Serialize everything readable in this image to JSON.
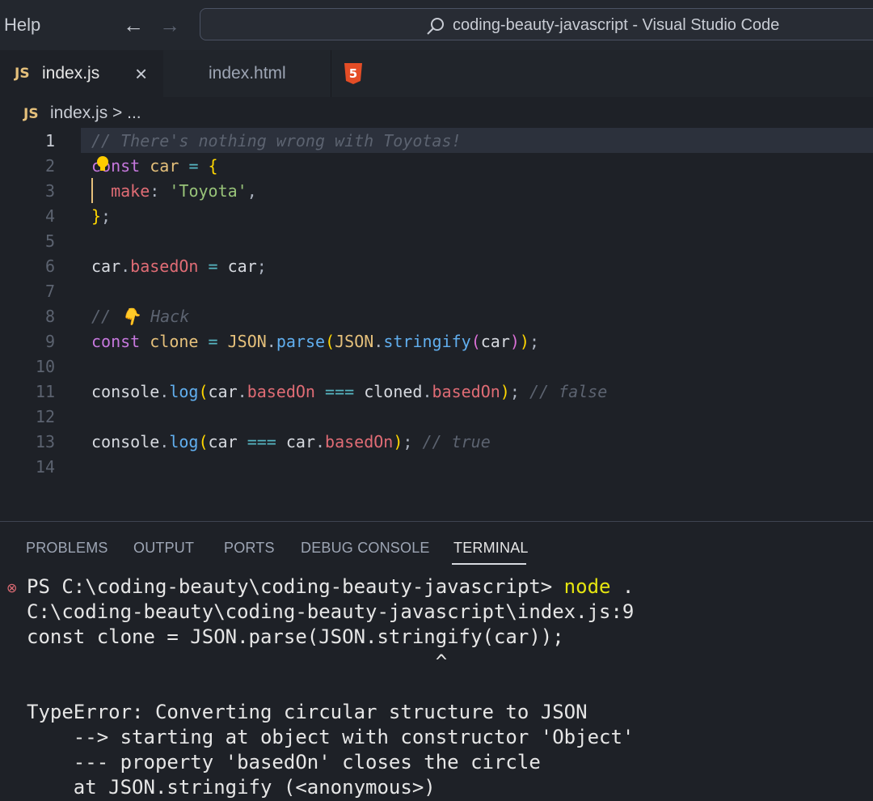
{
  "titlebar": {
    "menu_help": "Help",
    "back_icon": "arrow-left-icon",
    "forward_icon": "arrow-right-icon",
    "command_center_text": "coding-beauty-javascript - Visual Studio Code"
  },
  "tabs": [
    {
      "badge": "JS",
      "label": "index.js",
      "active": true,
      "close": "×"
    },
    {
      "badge": "5",
      "label": "index.html",
      "active": false
    }
  ],
  "breadcrumb": {
    "badge": "JS",
    "label": "index.js > ..."
  },
  "editor": {
    "line_numbers": [
      "1",
      "2",
      "3",
      "4",
      "5",
      "6",
      "7",
      "8",
      "9",
      "10",
      "11",
      "12",
      "13",
      "14"
    ],
    "active_line": 1
  },
  "panel": {
    "tabs": [
      "PROBLEMS",
      "OUTPUT",
      "PORTS",
      "DEBUG CONSOLE",
      "TERMINAL"
    ],
    "active_tab": "TERMINAL",
    "terminal": {
      "prompt": "PS C:\\coding-beauty\\coding-beauty-javascript> ",
      "command": "node",
      "command_arg": " .",
      "lines": [
        "C:\\coding-beauty\\coding-beauty-javascript\\index.js:9",
        "const clone = JSON.parse(JSON.stringify(car));",
        "                                   ^",
        "",
        "TypeError: Converting circular structure to JSON",
        "    --> starting at object with constructor 'Object'",
        "    --- property 'basedOn' closes the circle",
        "    at JSON.stringify (<anonymous>)"
      ]
    }
  },
  "colors": {
    "editor_bg": "#1e2127",
    "keyword": "#c678dd",
    "variable": "#e5c07b",
    "property": "#e06c75",
    "string": "#98c379",
    "function": "#61afef",
    "comment": "#5c6370"
  }
}
